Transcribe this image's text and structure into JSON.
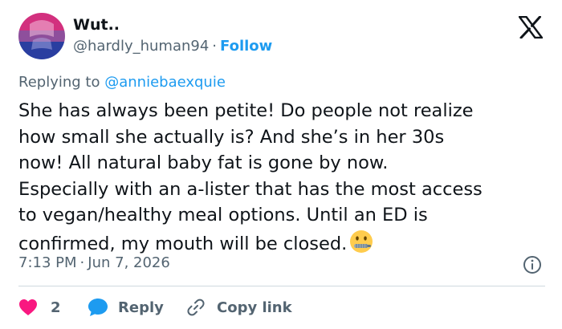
{
  "author": {
    "display_name": "Wut..",
    "handle": "@hardly_human94",
    "separator": "·",
    "follow_label": "Follow"
  },
  "reply": {
    "prefix": "Replying to",
    "mention": "@anniebaexquie"
  },
  "tweet": {
    "lines": [
      "She has always been petite! Do people not realize",
      "how small she actually is? And she’s in her 30s",
      "now! All natural baby fat is gone by now.",
      "Especially with an a-lister that has the most access",
      "to vegan/healthy meal options. Until an ED is",
      "confirmed, my mouth will be closed."
    ],
    "emoji_icon": "zipper-mouth-face-icon"
  },
  "meta": {
    "time": "7:13 PM",
    "separator": "·",
    "date": "Jun 7, 2026"
  },
  "actions": {
    "like_count": "2",
    "reply_label": "Reply",
    "copy_label": "Copy link"
  },
  "colors": {
    "text": "#0f1419",
    "secondary": "#536471",
    "link": "#1d9bf0",
    "like": "#f91880",
    "divider": "#cfd9de"
  }
}
